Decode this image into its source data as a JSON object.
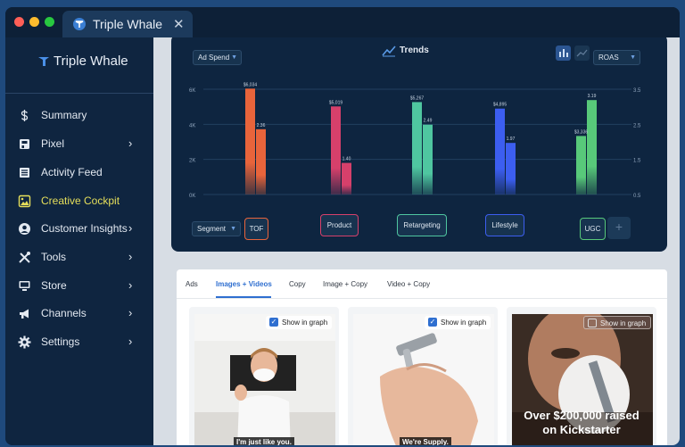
{
  "window": {
    "tab_title": "Triple Whale",
    "tab_close": "✕"
  },
  "sidebar": {
    "brand": "Triple Whale",
    "items": [
      {
        "label": "Summary",
        "icon": "dollar-icon",
        "chevron": false,
        "active": false
      },
      {
        "label": "Pixel",
        "icon": "pixel-icon",
        "chevron": true,
        "active": false
      },
      {
        "label": "Activity Feed",
        "icon": "list-icon",
        "chevron": false,
        "active": false
      },
      {
        "label": "Creative Cockpit",
        "icon": "image-icon",
        "chevron": false,
        "active": true
      },
      {
        "label": "Customer Insights",
        "icon": "user-icon",
        "chevron": true,
        "active": false
      },
      {
        "label": "Tools",
        "icon": "tools-icon",
        "chevron": true,
        "active": false
      },
      {
        "label": "Store",
        "icon": "store-icon",
        "chevron": true,
        "active": false
      },
      {
        "label": "Channels",
        "icon": "megaphone-icon",
        "chevron": true,
        "active": false
      },
      {
        "label": "Settings",
        "icon": "gear-icon",
        "chevron": true,
        "active": false
      }
    ],
    "chevron_glyph": "›",
    "active_color": "#e6df5a"
  },
  "toolbar": {
    "metric_select": "Ad Spend",
    "title": "Trends",
    "roas_select": "ROAS",
    "segment_select": "Segment"
  },
  "chart_data": {
    "type": "bar",
    "categories": [
      "TOF",
      "Product",
      "Retargeting",
      "Lifestyle",
      "UGC"
    ],
    "series": [
      {
        "axis": "left",
        "values": [
          6034,
          5019,
          5267,
          4895,
          3336
        ],
        "labels": [
          "$6,034",
          "$5,019",
          "$5,267",
          "$4,895",
          "$3,336"
        ]
      },
      {
        "axis": "right",
        "values": [
          2.36,
          1.4,
          2.49,
          1.97,
          3.19
        ],
        "labels": [
          "2.36",
          "1.40",
          "2.49",
          "1.97",
          "3.19"
        ]
      }
    ],
    "colors": [
      "#e8643b",
      "#d6406b",
      "#4fc6a0",
      "#3c5ef0",
      "#58c97a"
    ],
    "left_ticks": [
      "6K",
      "4K",
      "2K",
      "0K"
    ],
    "right_ticks": [
      "3.5",
      "2.5",
      "1.5",
      "0.5"
    ],
    "left_ylim": [
      0,
      6000
    ],
    "right_ylim": [
      0.5,
      3.5
    ],
    "add_button": "+"
  },
  "content": {
    "tabs": [
      {
        "label": "Ads",
        "active": false
      },
      {
        "label": "Images + Videos",
        "active": true
      },
      {
        "label": "Copy",
        "active": false
      },
      {
        "label": "Image + Copy",
        "active": false
      },
      {
        "label": "Video + Copy",
        "active": false
      }
    ],
    "show_label": "Show in graph",
    "creatives": [
      {
        "caption": "I'm just like you.",
        "checked": true
      },
      {
        "caption": "We're Supply.",
        "checked": true
      },
      {
        "overlay_line1": "Over $200,000 raised",
        "overlay_line2": "on Kickstarter",
        "checked": false
      }
    ]
  }
}
